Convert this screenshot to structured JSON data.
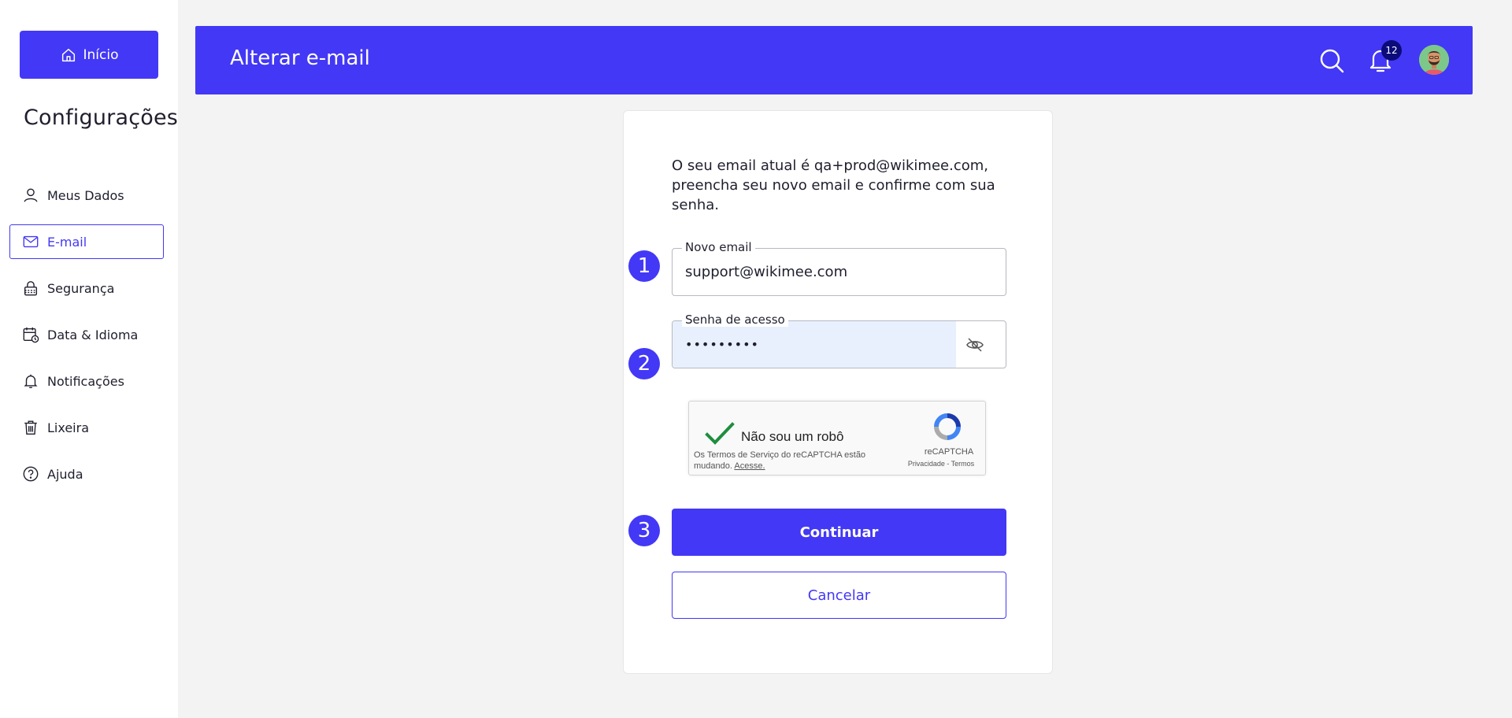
{
  "sidebar": {
    "home_label": "Início",
    "settings_title": "Configurações",
    "items": [
      {
        "label": "Meus Dados",
        "icon": "user-icon"
      },
      {
        "label": "E-mail",
        "icon": "mail-icon",
        "active": true
      },
      {
        "label": "Segurança",
        "icon": "lock-icon"
      },
      {
        "label": "Data & Idioma",
        "icon": "calendar-clock-icon"
      },
      {
        "label": "Notificações",
        "icon": "bell-icon"
      },
      {
        "label": "Lixeira",
        "icon": "trash-icon"
      },
      {
        "label": "Ajuda",
        "icon": "help-icon"
      }
    ]
  },
  "header": {
    "title": "Alterar e-mail",
    "notification_count": "12"
  },
  "form": {
    "intro": "O seu email atual é qa+prod@wikimee.com, preencha seu novo email e confirme com sua senha.",
    "email_label": "Novo email",
    "email_value": "support@wikimee.com",
    "password_label": "Senha de acesso",
    "password_value": "•••••••••",
    "steps": [
      "1",
      "2",
      "3"
    ],
    "captcha": {
      "label": "Não sou um robô",
      "note": "Os Termos de Serviço do reCAPTCHA estão mudando.",
      "note_link": "Acesse.",
      "brand": "reCAPTCHA",
      "links": "Privacidade - Termos"
    },
    "continue_label": "Continuar",
    "cancel_label": "Cancelar"
  },
  "colors": {
    "accent": "#4338f5",
    "badge": "#0b0b7a",
    "autofill": "#e8f0fe",
    "check": "#1e8e3e"
  }
}
